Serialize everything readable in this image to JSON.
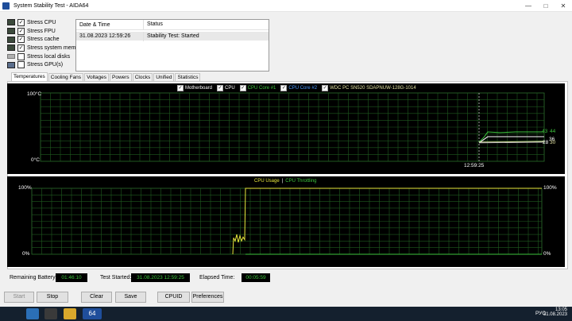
{
  "window": {
    "title": "System Stability Test - AIDA64"
  },
  "stress": [
    {
      "label": "Stress CPU",
      "checked": true,
      "icon": "cpu-chip-icon"
    },
    {
      "label": "Stress FPU",
      "checked": true,
      "icon": "fpu-chip-icon"
    },
    {
      "label": "Stress cache",
      "checked": true,
      "icon": "cache-chip-icon"
    },
    {
      "label": "Stress system memory",
      "checked": true,
      "icon": "memory-module-icon"
    },
    {
      "label": "Stress local disks",
      "checked": false,
      "icon": "disk-drive-icon"
    },
    {
      "label": "Stress GPU(s)",
      "checked": false,
      "icon": "gpu-card-icon"
    }
  ],
  "status": {
    "header_date": "Date & Time",
    "header_status": "Status",
    "date": "31.08.2023 12:59:26",
    "text": "Stability Test: Started"
  },
  "tabs": [
    "Temperatures",
    "Cooling Fans",
    "Voltages",
    "Powers",
    "Clocks",
    "Unified",
    "Statistics"
  ],
  "chart_data": [
    {
      "type": "line",
      "legend": [
        {
          "name": "Motherboard",
          "color": "#ffffff"
        },
        {
          "name": "CPU",
          "color": "#ffffff"
        },
        {
          "name": "CPU Core #1",
          "color": "#3cc43c"
        },
        {
          "name": "CPU Core #2",
          "color": "#4a9aff"
        },
        {
          "name": "WDC PC SN520 SDAPNUW-128G-1014",
          "color": "#e0e0a0"
        }
      ],
      "ylabel_top": "100°C",
      "ylabel_bottom": "0°C",
      "ylim": [
        0,
        100
      ],
      "time_label": "12:59:25",
      "end_values": [
        "43",
        "44",
        "36",
        "28",
        "30"
      ],
      "color_line": "#3cc43c"
    },
    {
      "type": "line",
      "legend": [
        {
          "name": "CPU Usage",
          "color": "#e8e83c"
        },
        {
          "name": "CPU Throttling",
          "color": "#3cc43c"
        }
      ],
      "ylabel_top_left": "100%",
      "ylabel_bottom_left": "0%",
      "ylabel_top_right": "100%",
      "ylabel_bottom_right": "0%",
      "ylim": [
        0,
        100
      ]
    }
  ],
  "info": {
    "battery_label": "Remaining Battery:",
    "battery_value": "01:46:10",
    "started_label": "Test Started:",
    "started_value": "31.08.2023 12:59:25",
    "elapsed_label": "Elapsed Time:",
    "elapsed_value": "00:05:59"
  },
  "buttons": {
    "start": "Start",
    "stop": "Stop",
    "clear": "Clear",
    "save": "Save",
    "cpuid": "CPUID",
    "preferences": "Preferences"
  },
  "taskbar": {
    "app_label": "64",
    "lang": "РУС",
    "time": "13:05",
    "date": "31.08.2023"
  }
}
